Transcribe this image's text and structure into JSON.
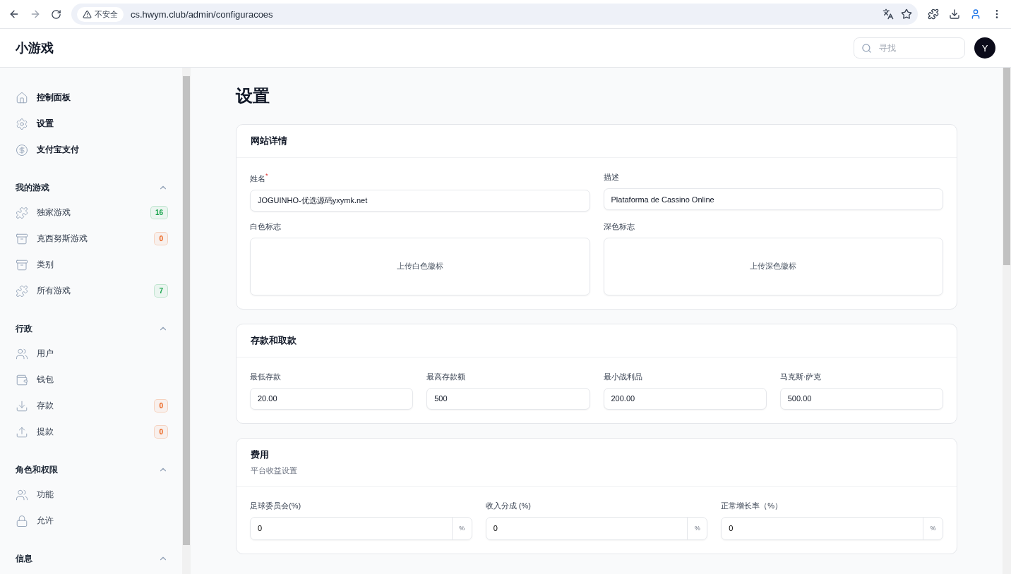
{
  "browser": {
    "security": "不安全",
    "url": "cs.hwym.club/admin/configuracoes"
  },
  "topbar": {
    "brand": "小游戏",
    "search": {
      "placeholder": "寻找"
    },
    "avatar": "Y"
  },
  "sidebar": {
    "top_items": [
      {
        "label": "控制面板"
      },
      {
        "label": "设置"
      },
      {
        "label": "支付宝支付"
      }
    ],
    "groups": [
      {
        "title": "我的游戏",
        "expanded": true,
        "items": [
          {
            "label": "独家游戏",
            "badge": {
              "text": "16",
              "color": "#16a34a"
            }
          },
          {
            "label": "克西努斯游戏",
            "badge": {
              "text": "0",
              "color": "#ea580c"
            }
          },
          {
            "label": "类别"
          },
          {
            "label": "所有游戏",
            "badge": {
              "text": "7",
              "color": "#16a34a"
            }
          }
        ]
      },
      {
        "title": "行政",
        "expanded": true,
        "items": [
          {
            "label": "用户"
          },
          {
            "label": "钱包"
          },
          {
            "label": "存款",
            "badge": {
              "text": "0",
              "color": "#ea580c"
            }
          },
          {
            "label": "提款",
            "badge": {
              "text": "0",
              "color": "#ea580c"
            }
          }
        ]
      },
      {
        "title": "角色和权限",
        "expanded": true,
        "items": [
          {
            "label": "功能"
          },
          {
            "label": "允许"
          }
        ]
      },
      {
        "title": "信息",
        "expanded": true
      }
    ]
  },
  "page": {
    "title": "设置",
    "cards": [
      {
        "kind": "details",
        "title": "网站详情",
        "fields": [
          {
            "label": "姓名",
            "required_mark": "*",
            "value": "JOGUINHO-优选源码yxymk.net"
          },
          {
            "label": "描述",
            "value": "Plataforma de Cassino Online"
          }
        ],
        "uploads": [
          {
            "label": "白色标志",
            "prompt": "上传白色徽标"
          },
          {
            "label": "深色标志",
            "prompt": "上传深色徽标"
          }
        ]
      },
      {
        "kind": "amounts",
        "title": "存款和取款",
        "fields": [
          {
            "label": "最低存款",
            "value": "20.00"
          },
          {
            "label": "最高存款额",
            "value": "500"
          },
          {
            "label": "最小战利品",
            "value": "200.00"
          },
          {
            "label": "马克斯·萨克",
            "value": "500.00"
          }
        ]
      },
      {
        "kind": "fees",
        "title": "费用",
        "subtitle": "平台收益设置",
        "fields": [
          {
            "label": "足球委员会(%)",
            "value": "0",
            "suffix": "%"
          },
          {
            "label": "收入分成 (%)",
            "value": "0",
            "suffix": "%"
          },
          {
            "label": "正常增长率（%）",
            "value": "0",
            "suffix": "%"
          }
        ]
      }
    ]
  }
}
